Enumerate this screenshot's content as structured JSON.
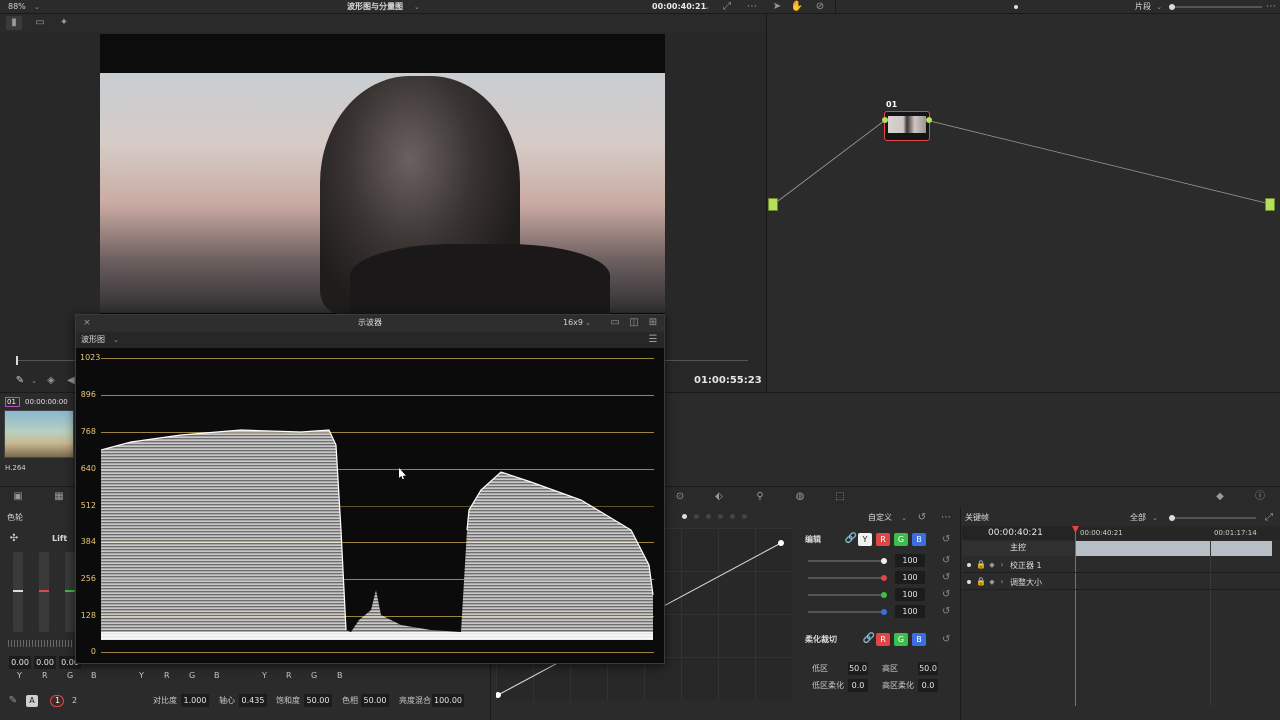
{
  "top_bar": {
    "zoom": "88%",
    "viewer_title": "波形图与分量图",
    "timecode": "00:00:40:21",
    "clip_mode": "片段"
  },
  "viewer": {
    "bottom_timecode": "01:00:55:23"
  },
  "clip": {
    "number": "01",
    "timecode": "00:00:00:00",
    "codec": "H.264"
  },
  "node_graph": {
    "node_label": "01"
  },
  "scope_window": {
    "title": "示波器",
    "aspect": "16x9",
    "scope_type": "波形图",
    "ticks": [
      "1023",
      "896",
      "768",
      "640",
      "512",
      "384",
      "256",
      "128",
      "0"
    ]
  },
  "color_wheels": {
    "title": "色轮",
    "wheel_label": "Lift",
    "values": [
      "0.00",
      "0.00",
      "0.00"
    ],
    "channel_labels": [
      "Y",
      "R",
      "G",
      "B"
    ],
    "group2_labels": [
      "Y",
      "R",
      "G",
      "B"
    ],
    "group3_labels": [
      "Y",
      "R",
      "G",
      "B"
    ],
    "page_1": "1",
    "page_2": "2",
    "bottom_params": [
      {
        "label": "对比度",
        "value": "1.000"
      },
      {
        "label": "轴心",
        "value": "0.435"
      },
      {
        "label": "饱和度",
        "value": "50.00"
      },
      {
        "label": "色相",
        "value": "50.00"
      },
      {
        "label": "亮度混合",
        "value": "100.00"
      }
    ]
  },
  "curves": {
    "preset": "自定义",
    "edit_label": "编辑",
    "channel_btns": [
      "Y",
      "R",
      "G",
      "B"
    ],
    "channel_values": [
      "100",
      "100",
      "100",
      "100"
    ],
    "soft_clip_label": "柔化裁切",
    "soft_clip_btns": [
      "R",
      "G",
      "B"
    ],
    "low_label": "低区",
    "low_value": "50.0",
    "high_label": "高区",
    "high_value": "50.0",
    "low_soft_label": "低区柔化",
    "low_soft_value": "0.0",
    "high_soft_label": "高区柔化",
    "high_soft_value": "0.0"
  },
  "keyframes": {
    "title": "关键帧",
    "filter": "全部",
    "current_tc": "00:00:40:21",
    "ruler_start": "00:00:40:21",
    "ruler_end": "00:01:17:14",
    "master_label": "主控",
    "tracks": [
      "校正器 1",
      "调整大小"
    ]
  },
  "colors": {
    "accent_red": "#e04646",
    "accent_green": "#3bbf4a",
    "accent_blue": "#3b6fe0",
    "node_lime": "#b4e05a",
    "scope_gold": "#e7c777"
  }
}
